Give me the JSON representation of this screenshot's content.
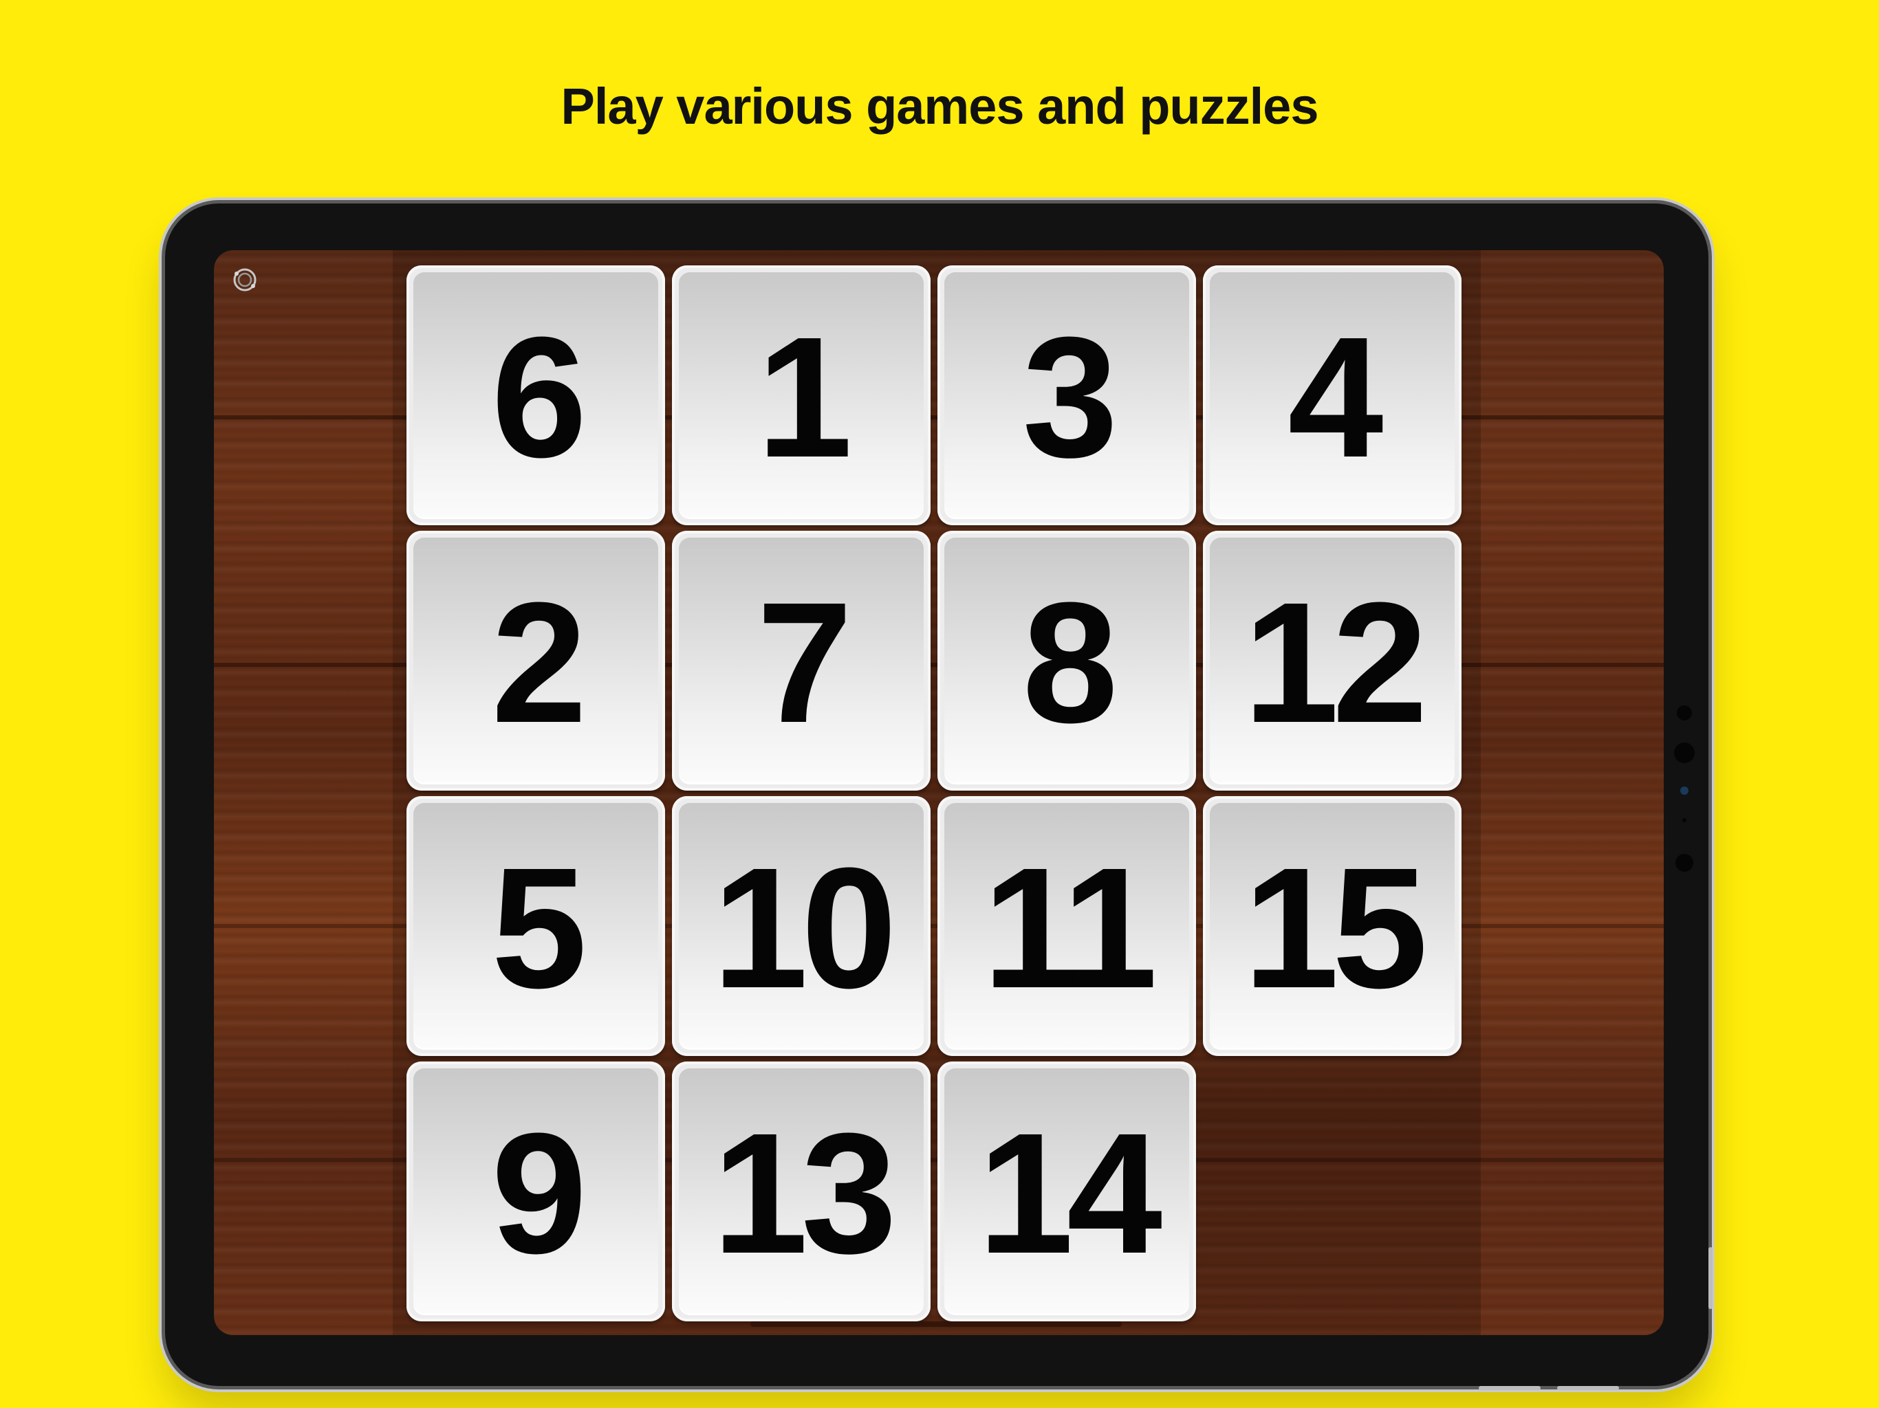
{
  "headline": "Play various games and puzzles",
  "app": {
    "menu_icon": "settings-ring-icon",
    "background": "wood-texture",
    "colors": {
      "page_background": "#FFEC0A",
      "tile_face": "#ECECEC",
      "tile_text": "#050505",
      "wood": "#6E3318"
    }
  },
  "puzzle": {
    "type": "15-puzzle",
    "rows": 4,
    "cols": 4,
    "tiles": [
      "6",
      "1",
      "3",
      "4",
      "2",
      "7",
      "8",
      "12",
      "5",
      "10",
      "11",
      "15",
      "9",
      "13",
      "14",
      ""
    ]
  }
}
